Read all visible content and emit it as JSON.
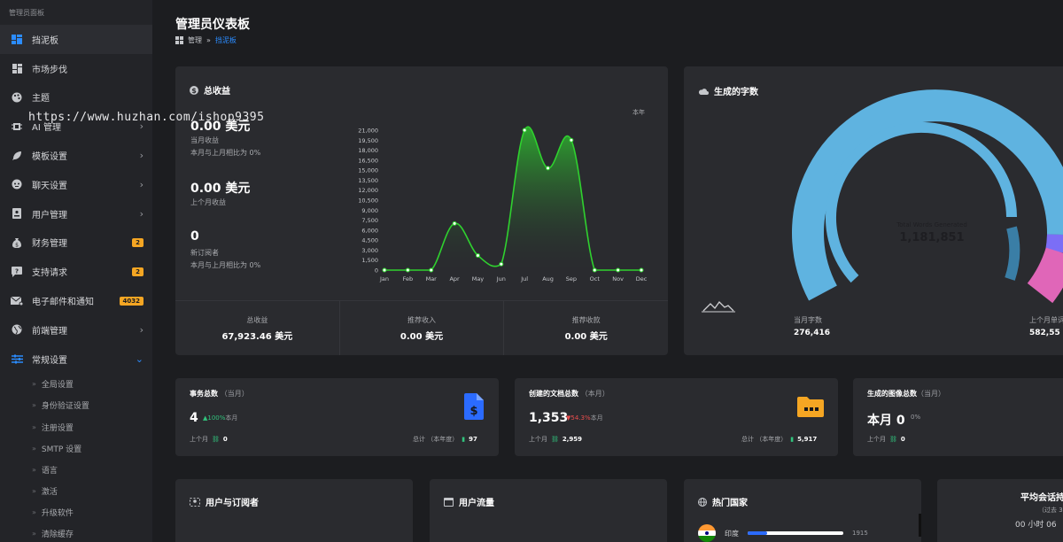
{
  "sidebar": {
    "title": "管理员面板",
    "items": [
      {
        "label": "挡泥板",
        "icon": "dashboard-icon",
        "active": true
      },
      {
        "label": "市场步伐",
        "icon": "grid-icon"
      },
      {
        "label": "主题",
        "icon": "palette-icon"
      },
      {
        "label": "AI 管理",
        "icon": "chip-icon",
        "chevron": "›"
      },
      {
        "label": "模板设置",
        "icon": "feather-icon",
        "chevron": "›"
      },
      {
        "label": "聊天设置",
        "icon": "robot-icon",
        "chevron": "›"
      },
      {
        "label": "用户管理",
        "icon": "id-card-icon",
        "chevron": "›"
      },
      {
        "label": "财务管理",
        "icon": "money-bag-icon",
        "badge": "2"
      },
      {
        "label": "支持请求",
        "icon": "question-icon",
        "badge": "2"
      },
      {
        "label": "电子邮件和通知",
        "icon": "mail-icon",
        "badge": "4032"
      },
      {
        "label": "前端管理",
        "icon": "globe-icon",
        "chevron": "›"
      },
      {
        "label": "常规设置",
        "icon": "sliders-icon",
        "chevron": "⌄",
        "open": true
      }
    ],
    "subitems": [
      "全局设置",
      "身份验证设置",
      "注册设置",
      "SMTP 设置",
      "语言",
      "激活",
      "升级软件",
      "清除缓存"
    ]
  },
  "header": {
    "title": "管理员仪表板",
    "breadcrumb": {
      "root": "管理",
      "sep": "»",
      "current": "挡泥板"
    }
  },
  "revenue": {
    "title": "总收益",
    "current_value": "0.00 美元",
    "current_label": "当月收益",
    "current_compare": "本月与上月相比为 0%",
    "prev_value": "0.00 美元",
    "prev_label": "上个月收益",
    "subs_value": "0",
    "subs_label": "新订阅者",
    "subs_compare": "本月与上月相比为 0%",
    "year_label": "本年",
    "footer": [
      {
        "label": "总收益",
        "value": "67,923.46 美元"
      },
      {
        "label": "推荐收入",
        "value": "0.00 美元"
      },
      {
        "label": "推荐收款",
        "value": "0.00 美元"
      }
    ]
  },
  "chart_data": {
    "type": "area",
    "categories": [
      "Jan",
      "Feb",
      "Mar",
      "Apr",
      "May",
      "Jun",
      "Jul",
      "Aug",
      "Sep",
      "Oct",
      "Nov",
      "Dec"
    ],
    "values": [
      0,
      0,
      0,
      7000,
      2200,
      900,
      21000,
      15300,
      19500,
      0,
      0,
      0
    ],
    "y_ticks": [
      "0",
      "1,500",
      "3,000",
      "4,500",
      "6,000",
      "7,500",
      "9,000",
      "10,500",
      "12,000",
      "13,500",
      "15,000",
      "16,500",
      "18,000",
      "19,500",
      "21,000"
    ],
    "ylim": [
      0,
      21000
    ],
    "color": "#2fd12f"
  },
  "words": {
    "title": "生成的字数",
    "center_label": "Total Words Generated",
    "center_value": "1,181,851",
    "this_month_label": "当月字数",
    "this_month_value": "276,416",
    "last_month_label": "上个月单词",
    "last_month_value": "582,55",
    "colors": {
      "main": "#5fb3e0",
      "purple": "#7b6ef6",
      "pink": "#e066b8",
      "inner": "#5fb3e0",
      "inner_dark": "#3a7ea6"
    }
  },
  "tasks": {
    "title": "事务总数",
    "period": "（当月）",
    "value": "4",
    "delta_arrow": "▲",
    "delta_pct": "100%",
    "delta_suffix": "本月",
    "last_label": "上个月",
    "last_value": "0",
    "total_label": "总计 （本年度）",
    "total_value": "97"
  },
  "docs": {
    "title": "创建的文档总数",
    "period": "（本月）",
    "value": "1,353",
    "delta_arrow": "▼",
    "delta_pct": "54.3%",
    "delta_suffix": "本月",
    "last_label": "上个月",
    "last_value": "2,959",
    "total_label": "总计 （本年度）",
    "total_value": "5,917"
  },
  "images": {
    "title": "生成的图像总数",
    "period": "（当月）",
    "value": "本月 0",
    "delta_pct": "0%",
    "last_label": "上个月",
    "last_value": "0"
  },
  "bottom": {
    "users_title": "用户与订阅者",
    "traffic_title": "用户流量",
    "countries_title": "热门国家",
    "country_name": "印度",
    "country_value": "1915",
    "country_fill": 0.2,
    "session_title": "平均会话持",
    "session_sub": "（过去 3",
    "session_value": "00 小时 06"
  },
  "watermark": "https://www.huzhan.com/ishop9395"
}
